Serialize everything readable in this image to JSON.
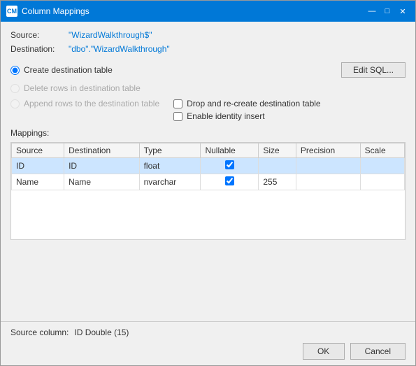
{
  "window": {
    "title": "Column Mappings",
    "icon": "CM"
  },
  "titlebar_controls": {
    "minimize": "—",
    "maximize": "□",
    "close": "✕"
  },
  "source_label": "Source:",
  "source_value": "\"WizardWalkthrough$\"",
  "destination_label": "Destination:",
  "destination_value": "\"dbo\".\"WizardWalkthrough\"",
  "radio_options": {
    "create": {
      "label": "Create destination table",
      "checked": true,
      "enabled": true
    },
    "delete": {
      "label": "Delete rows in destination table",
      "checked": false,
      "enabled": false
    },
    "append": {
      "label": "Append rows to the destination table",
      "checked": false,
      "enabled": false
    }
  },
  "edit_sql_button": "Edit SQL...",
  "checkboxes": {
    "drop_recreate": {
      "label": "Drop and re-create destination table",
      "checked": false
    },
    "enable_identity": {
      "label": "Enable identity insert",
      "checked": false
    }
  },
  "mappings_label": "Mappings:",
  "table": {
    "headers": [
      "Source",
      "Destination",
      "Type",
      "Nullable",
      "Size",
      "Precision",
      "Scale"
    ],
    "rows": [
      {
        "source": "ID",
        "destination": "ID",
        "type": "float",
        "nullable": true,
        "size": "",
        "precision": "",
        "scale": "",
        "selected": true
      },
      {
        "source": "Name",
        "destination": "Name",
        "type": "nvarchar",
        "nullable": true,
        "size": "255",
        "precision": "",
        "scale": "",
        "selected": false
      }
    ]
  },
  "source_column_label": "Source column:",
  "source_column_value": "ID Double (15)",
  "buttons": {
    "ok": "OK",
    "cancel": "Cancel"
  }
}
